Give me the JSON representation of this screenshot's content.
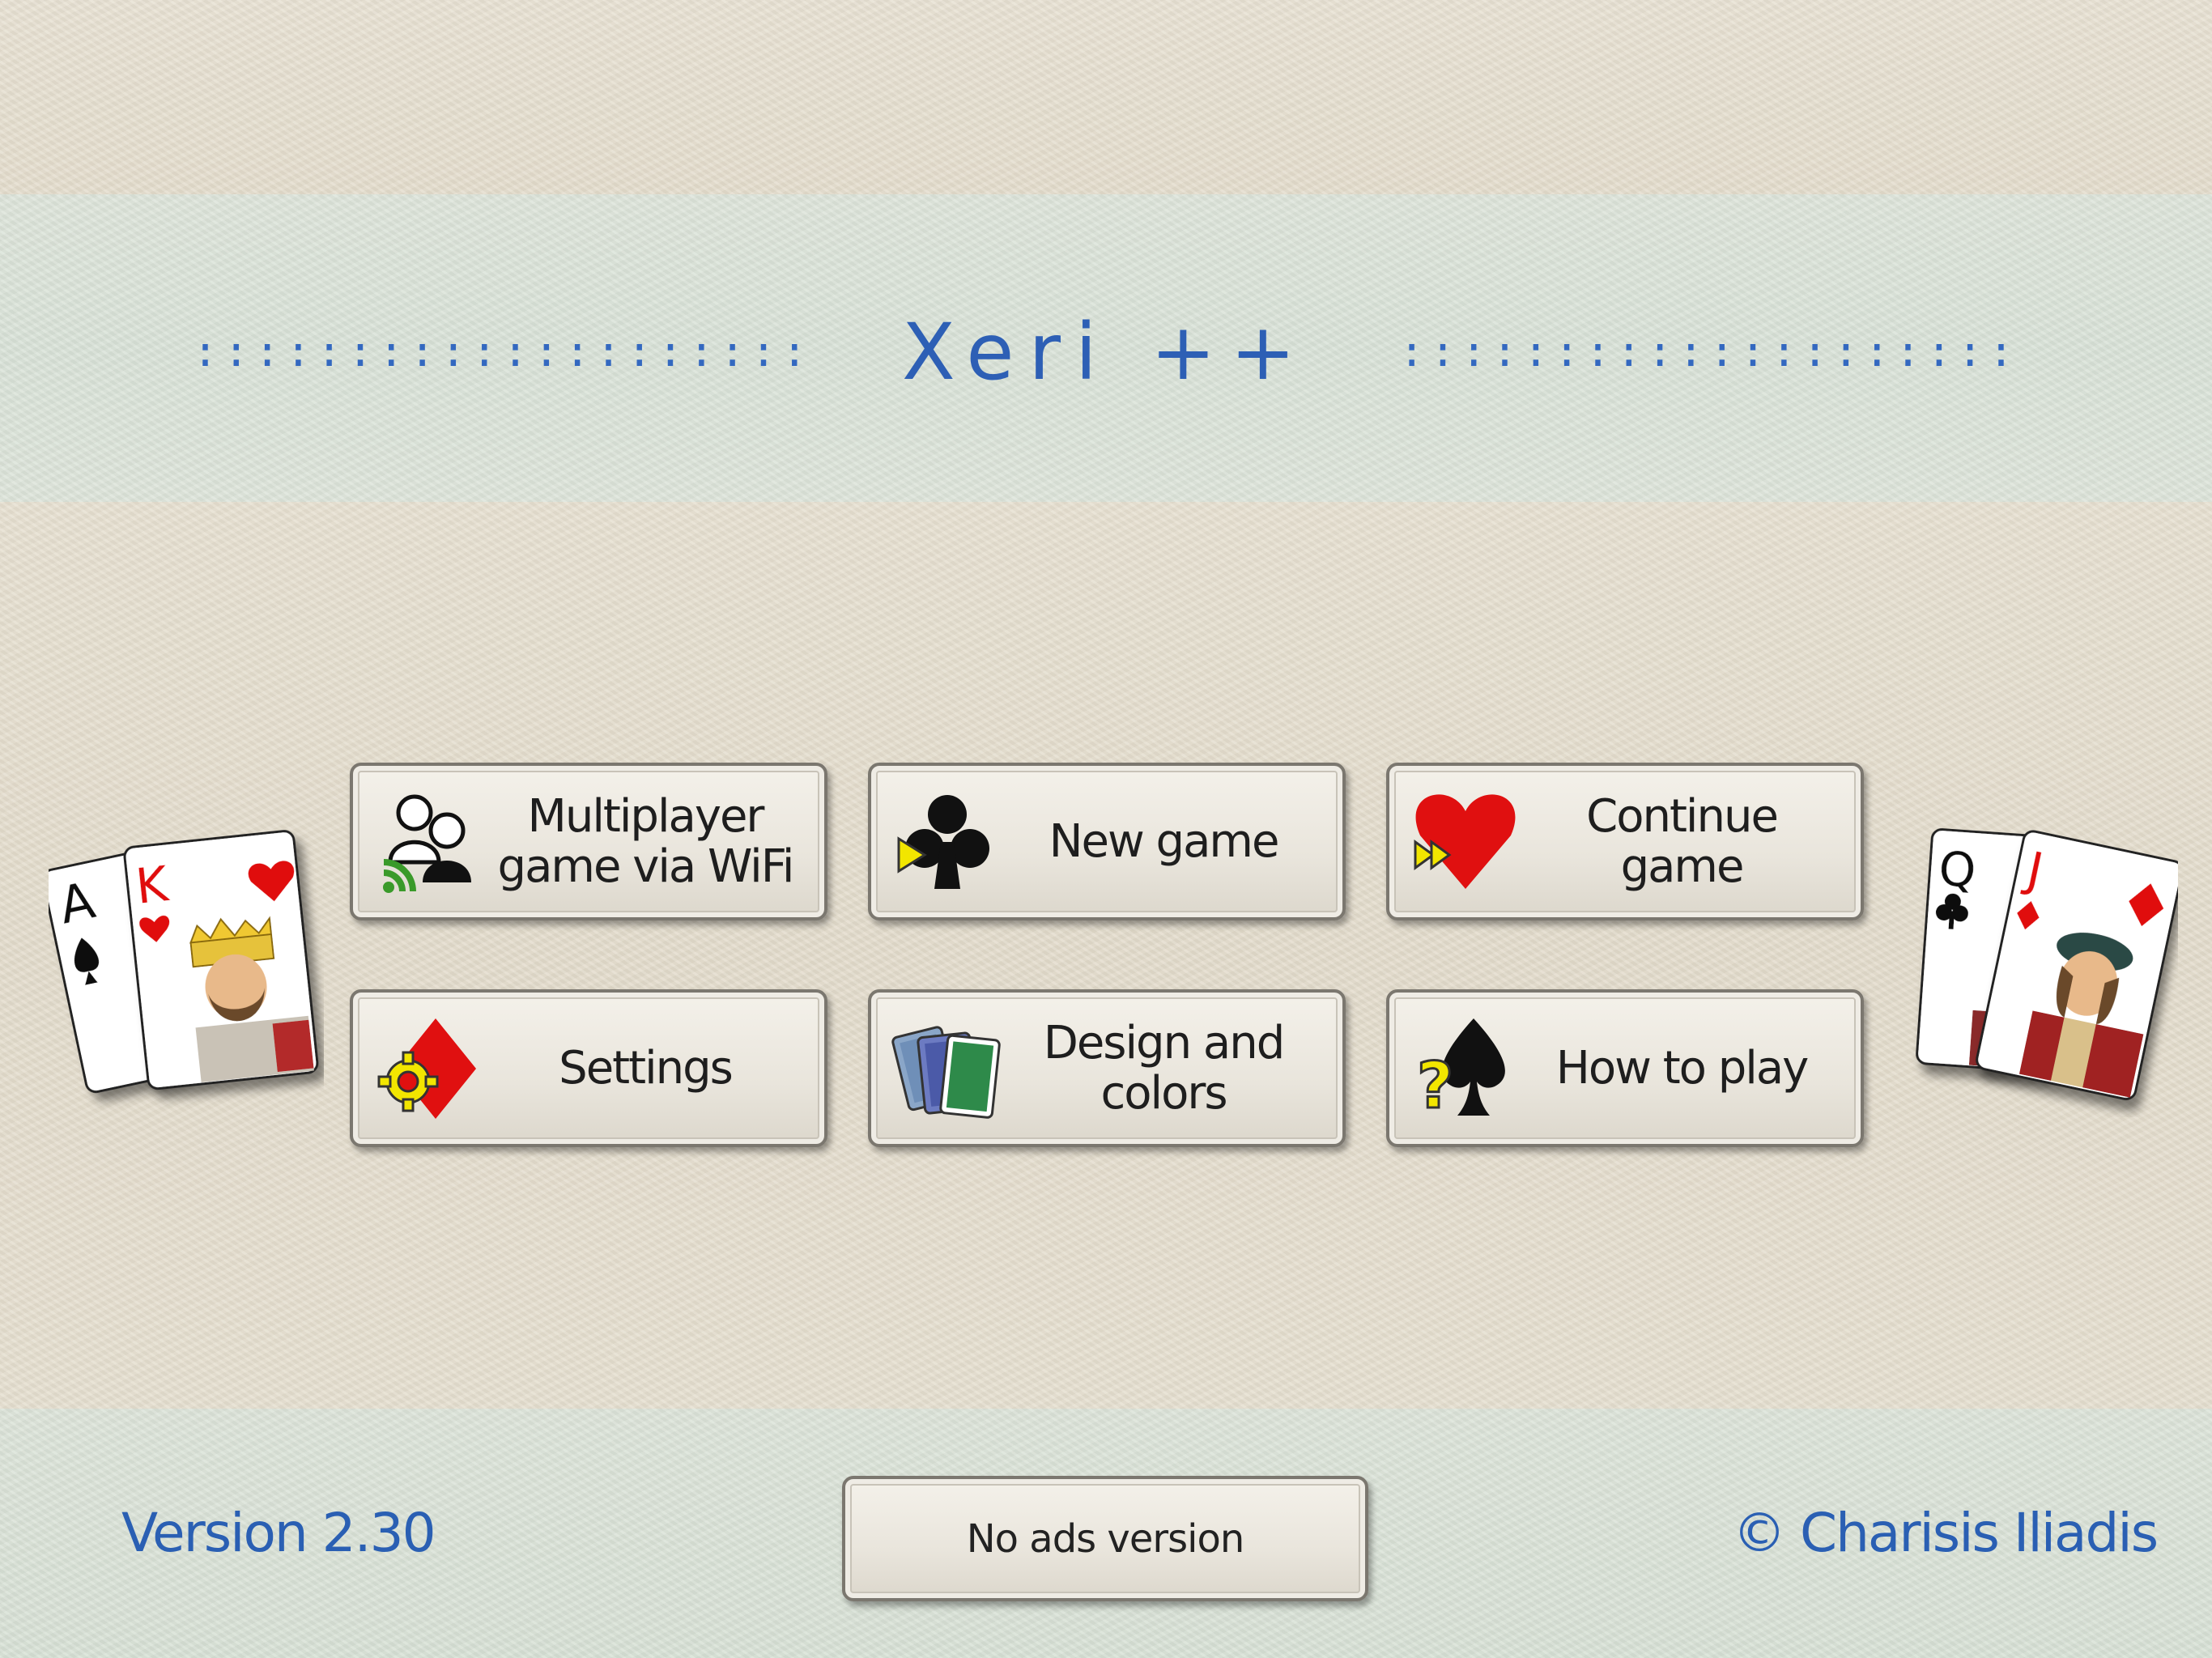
{
  "app": {
    "title": "Xeri ++",
    "title_dots": "::::::::::::::::::::"
  },
  "menu": {
    "multiplayer": {
      "label": "Multiplayer\ngame via WiFi",
      "icon": "multiplayer-wifi-icon"
    },
    "new_game": {
      "label": "New game",
      "icon": "club-play-icon"
    },
    "continue_game": {
      "label": "Continue game",
      "icon": "heart-fast-forward-icon"
    },
    "settings": {
      "label": "Settings",
      "icon": "diamond-gear-icon"
    },
    "design": {
      "label": "Design and\ncolors",
      "icon": "card-backs-icon"
    },
    "how_to_play": {
      "label": "How to play",
      "icon": "spade-question-icon"
    }
  },
  "footer": {
    "version": "Version 2.30",
    "no_ads": "No ads version",
    "copyright": "© Charisis Iliadis"
  },
  "cards_left": [
    {
      "rank": "A",
      "suit": "spade",
      "color": "#111111"
    },
    {
      "rank": "K",
      "suit": "heart",
      "color": "#e01010"
    }
  ],
  "cards_right": [
    {
      "rank": "Q",
      "suit": "club",
      "color": "#111111"
    },
    {
      "rank": "J",
      "suit": "diamond",
      "color": "#e01010"
    }
  ],
  "colors": {
    "title_blue": "#2d5fb5",
    "red": "#e01010",
    "yellow": "#f2e600",
    "green": "#3a9a2a"
  }
}
